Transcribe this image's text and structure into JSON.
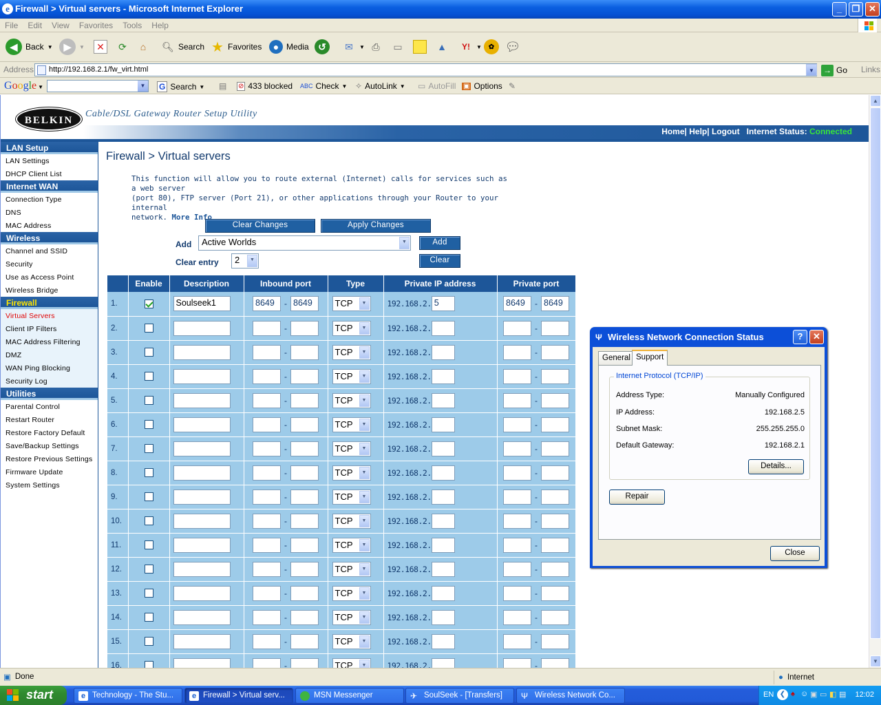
{
  "window": {
    "title": "Firewall > Virtual servers - Microsoft Internet Explorer"
  },
  "menu": [
    "File",
    "Edit",
    "View",
    "Favorites",
    "Tools",
    "Help"
  ],
  "toolbar": {
    "back": "Back",
    "search": "Search",
    "favorites": "Favorites",
    "media": "Media"
  },
  "address": {
    "label": "Address",
    "url": "http://192.168.2.1/fw_virt.html",
    "go": "Go",
    "links": "Links"
  },
  "google_bar": {
    "search": "Search",
    "blocked": "433 blocked",
    "check": "Check",
    "autolink": "AutoLink",
    "autofill": "AutoFill",
    "options": "Options"
  },
  "header": {
    "logo": "BELKIN",
    "tagline": "Cable/DSL Gateway Router Setup Utility",
    "home": "Home",
    "help": "Help",
    "logout": "Logout",
    "status_label": "Internet Status:",
    "status_value": "Connected"
  },
  "sidebar": {
    "lan_title": "LAN Setup",
    "lan": [
      "LAN Settings",
      "DHCP Client List"
    ],
    "wan_title": "Internet WAN",
    "wan": [
      "Connection Type",
      "DNS",
      "MAC Address"
    ],
    "wireless_title": "Wireless",
    "wireless": [
      "Channel and SSID",
      "Security",
      "Use as Access Point",
      "Wireless Bridge"
    ],
    "firewall_title": "Firewall",
    "firewall": [
      "Virtual Servers",
      "Client IP Filters",
      "MAC Address Filtering",
      "DMZ",
      "WAN Ping Blocking",
      "Security Log"
    ],
    "utilities_title": "Utilities",
    "utilities": [
      "Parental Control",
      "Restart Router",
      "Restore Factory Default",
      "Save/Backup Settings",
      "Restore Previous Settings",
      "Firmware Update",
      "System Settings"
    ]
  },
  "content": {
    "title": "Firewall > Virtual servers",
    "desc_line1": "This function will allow you to route external (Internet) calls for services such as a web server",
    "desc_line2": "(port 80), FTP server (Port 21), or other applications through your Router to your internal",
    "desc_line3": "network.",
    "more_info": "More Info",
    "clear_changes": "Clear Changes",
    "apply_changes": "Apply Changes",
    "add_label": "Add",
    "add_selected": "Active Worlds",
    "add_button": "Add",
    "clear_entry_label": "Clear entry",
    "clear_entry_selected": "2",
    "clear_button": "Clear",
    "columns": [
      "Enable",
      "Description",
      "Inbound port",
      "Type",
      "Private IP address",
      "Private port"
    ],
    "ip_prefix": "192.168.2.",
    "rows": [
      {
        "n": "1.",
        "enabled": true,
        "desc": "Soulseek1",
        "in_from": "8649",
        "in_to": "8649",
        "type": "TCP",
        "ip": "5",
        "priv_from": "8649",
        "priv_to": "8649"
      },
      {
        "n": "2.",
        "enabled": false,
        "desc": "",
        "in_from": "",
        "in_to": "",
        "type": "TCP",
        "ip": "",
        "priv_from": "",
        "priv_to": ""
      },
      {
        "n": "3.",
        "enabled": false,
        "desc": "",
        "in_from": "",
        "in_to": "",
        "type": "TCP",
        "ip": "",
        "priv_from": "",
        "priv_to": ""
      },
      {
        "n": "4.",
        "enabled": false,
        "desc": "",
        "in_from": "",
        "in_to": "",
        "type": "TCP",
        "ip": "",
        "priv_from": "",
        "priv_to": ""
      },
      {
        "n": "5.",
        "enabled": false,
        "desc": "",
        "in_from": "",
        "in_to": "",
        "type": "TCP",
        "ip": "",
        "priv_from": "",
        "priv_to": ""
      },
      {
        "n": "6.",
        "enabled": false,
        "desc": "",
        "in_from": "",
        "in_to": "",
        "type": "TCP",
        "ip": "",
        "priv_from": "",
        "priv_to": ""
      },
      {
        "n": "7.",
        "enabled": false,
        "desc": "",
        "in_from": "",
        "in_to": "",
        "type": "TCP",
        "ip": "",
        "priv_from": "",
        "priv_to": ""
      },
      {
        "n": "8.",
        "enabled": false,
        "desc": "",
        "in_from": "",
        "in_to": "",
        "type": "TCP",
        "ip": "",
        "priv_from": "",
        "priv_to": ""
      },
      {
        "n": "9.",
        "enabled": false,
        "desc": "",
        "in_from": "",
        "in_to": "",
        "type": "TCP",
        "ip": "",
        "priv_from": "",
        "priv_to": ""
      },
      {
        "n": "10.",
        "enabled": false,
        "desc": "",
        "in_from": "",
        "in_to": "",
        "type": "TCP",
        "ip": "",
        "priv_from": "",
        "priv_to": ""
      },
      {
        "n": "11.",
        "enabled": false,
        "desc": "",
        "in_from": "",
        "in_to": "",
        "type": "TCP",
        "ip": "",
        "priv_from": "",
        "priv_to": ""
      },
      {
        "n": "12.",
        "enabled": false,
        "desc": "",
        "in_from": "",
        "in_to": "",
        "type": "TCP",
        "ip": "",
        "priv_from": "",
        "priv_to": ""
      },
      {
        "n": "13.",
        "enabled": false,
        "desc": "",
        "in_from": "",
        "in_to": "",
        "type": "TCP",
        "ip": "",
        "priv_from": "",
        "priv_to": ""
      },
      {
        "n": "14.",
        "enabled": false,
        "desc": "",
        "in_from": "",
        "in_to": "",
        "type": "TCP",
        "ip": "",
        "priv_from": "",
        "priv_to": ""
      },
      {
        "n": "15.",
        "enabled": false,
        "desc": "",
        "in_from": "",
        "in_to": "",
        "type": "TCP",
        "ip": "",
        "priv_from": "",
        "priv_to": ""
      },
      {
        "n": "16.",
        "enabled": false,
        "desc": "",
        "in_from": "",
        "in_to": "",
        "type": "TCP",
        "ip": "",
        "priv_from": "",
        "priv_to": ""
      }
    ]
  },
  "dialog": {
    "title": "Wireless Network Connection Status",
    "tab_general": "General",
    "tab_support": "Support",
    "group": "Internet Protocol (TCP/IP)",
    "address_type_label": "Address Type:",
    "address_type": "Manually Configured",
    "ip_label": "IP Address:",
    "ip": "192.168.2.5",
    "mask_label": "Subnet Mask:",
    "mask": "255.255.255.0",
    "gateway_label": "Default Gateway:",
    "gateway": "192.168.2.1",
    "details": "Details...",
    "repair": "Repair",
    "close": "Close"
  },
  "statusbar": {
    "text": "Done",
    "zone": "Internet"
  },
  "taskbar": {
    "start": "start",
    "tasks": [
      "Technology - The Stu...",
      "Firewall > Virtual serv...",
      "MSN Messenger",
      "SoulSeek - [Transfers]",
      "Wireless Network Co..."
    ],
    "lang": "EN",
    "time": "12:02"
  }
}
